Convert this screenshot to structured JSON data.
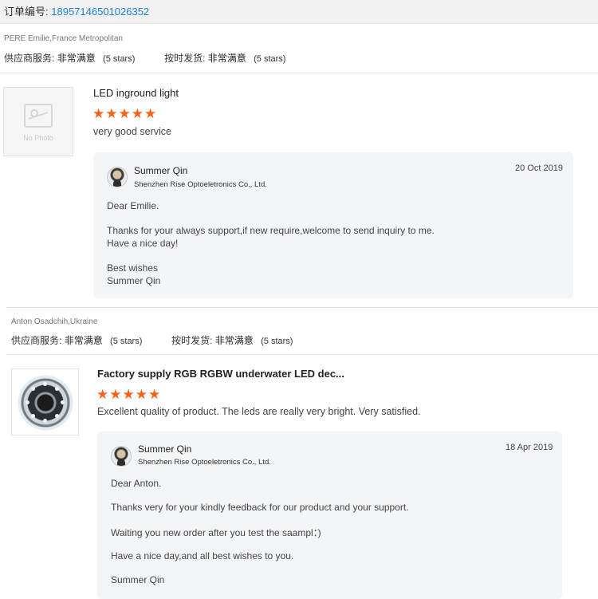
{
  "order": {
    "label": "订单编号:",
    "number": "18957146501026352"
  },
  "reviews": [
    {
      "reviewer": "PERE Emilie,France Metropolitan",
      "supplier_label": "供应商服务:",
      "supplier_value": "非常满意",
      "supplier_stars": "(5 stars)",
      "shipping_label": "按时发货:",
      "shipping_value": "非常满意",
      "shipping_stars": "(5 stars)",
      "thumb_text": "No Photo",
      "product_title": "LED inground light",
      "rating": 5,
      "stars": "★★★★★",
      "comment": "very good service",
      "reply": {
        "name": "Summer Qin",
        "company": "Shenzhen Rise Optoeletronics Co., Ltd.",
        "date": "20 Oct 2019",
        "lines": [
          "Dear Emilie.",
          "Thanks for your always support,if new require,welcome to send inquiry to me.",
          "Have a nice day!",
          "Best wishes",
          "Summer Qin"
        ]
      }
    },
    {
      "reviewer": "Anton Osadchih,Ukraine",
      "supplier_label": "供应商服务:",
      "supplier_value": "非常满意",
      "supplier_stars": "(5 stars)",
      "shipping_label": "按时发货:",
      "shipping_value": "非常满意",
      "shipping_stars": "(5 stars)",
      "product_title": "Factory supply RGB RGBW underwater LED dec...",
      "rating": 5,
      "stars": "★★★★★",
      "comment": "Excellent quality of product. The leds are really very bright. Very satisfied.",
      "reply": {
        "name": "Summer Qin",
        "company": "Shenzhen Rise Optoeletronics Co., Ltd.",
        "date": "18 Apr 2019",
        "lines": [
          "Dear Anton.",
          "Thanks very for your kindly  feedback for our product and your support.",
          "Waiting you new order after you test the saampl：)",
          "Have a nice day,and all best wishes to you.",
          "Summer Qin"
        ]
      }
    }
  ],
  "colors": {
    "star": "#f6621a",
    "order_number": "#1d80d8",
    "reply_bg": "#f4f5f7"
  }
}
